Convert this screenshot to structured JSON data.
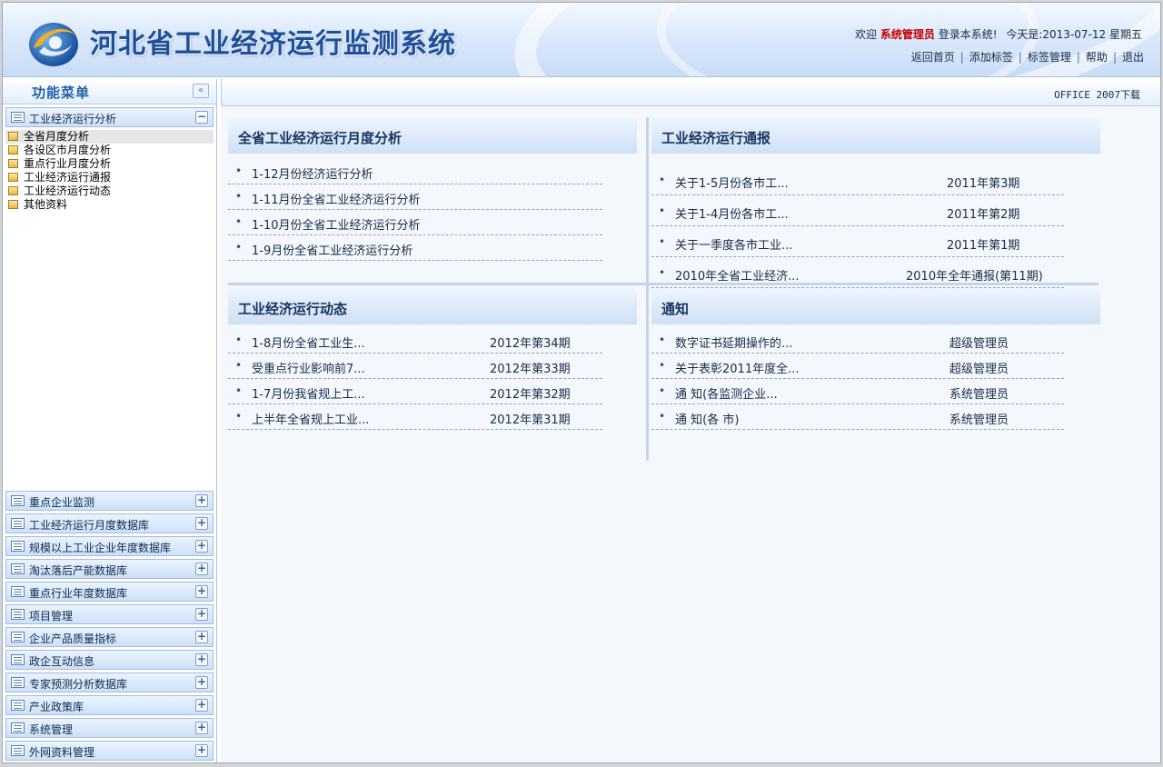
{
  "header": {
    "site_title": "河北省工业经济运行监测系统",
    "welcome_prefix": "欢迎",
    "user": "系统管理员",
    "welcome_suffix": "登录本系统!",
    "today_label": "今天是:",
    "date": "2013-07-12",
    "weekday": "星期五",
    "links": [
      "返回首页",
      "添加标签",
      "标签管理",
      "帮助",
      "退出"
    ]
  },
  "sidebar": {
    "title": "功能菜单",
    "collapse_glyph": "«",
    "active_menu": {
      "label": "工业经济运行分析",
      "toggle": "−",
      "items": [
        "全省月度分析",
        "各设区市月度分析",
        "重点行业月度分析",
        "工业经济运行通报",
        "工业经济运行动态",
        "其他资料"
      ]
    },
    "menus": [
      "重点企业监测",
      "工业经济运行月度数据库",
      "规模以上工业企业年度数据库",
      "淘汰落后产能数据库",
      "重点行业年度数据库",
      "项目管理",
      "企业产品质量指标",
      "政企互动信息",
      "专家预测分析数据库",
      "产业政策库",
      "系统管理",
      "外网资料管理"
    ],
    "expand_glyph": "+"
  },
  "main": {
    "office_link": "OFFICE 2007下载",
    "panels": {
      "monthly": {
        "title": "全省工业经济运行月度分析",
        "rows": [
          {
            "title": "1-12月份经济运行分析"
          },
          {
            "title": "1-11月份全省工业经济运行分析"
          },
          {
            "title": "1-10月份全省工业经济运行分析"
          },
          {
            "title": "1-9月份全省工业经济运行分析"
          }
        ]
      },
      "bulletin": {
        "title": "工业经济运行通报",
        "rows": [
          {
            "title": "关于1-5月份各市工...",
            "meta": "2011年第3期"
          },
          {
            "title": "关于1-4月份各市工...",
            "meta": "2011年第2期"
          },
          {
            "title": "关于一季度各市工业...",
            "meta": "2011年第1期"
          },
          {
            "title": "2010年全省工业经济...",
            "meta": "2010年全年通报(第11期)"
          }
        ]
      },
      "dynamics": {
        "title": "工业经济运行动态",
        "rows": [
          {
            "title": "1-8月份全省工业生...",
            "meta": "2012年第34期"
          },
          {
            "title": "受重点行业影响前7...",
            "meta": "2012年第33期"
          },
          {
            "title": "1-7月份我省规上工...",
            "meta": "2012年第32期"
          },
          {
            "title": "上半年全省规上工业...",
            "meta": "2012年第31期"
          }
        ]
      },
      "notice": {
        "title": "通知",
        "rows": [
          {
            "title": "数字证书延期操作的...",
            "meta": "超级管理员"
          },
          {
            "title": "关于表彰2011年度全...",
            "meta": "超级管理员"
          },
          {
            "title": "通 知(各监测企业...",
            "meta": "系统管理员"
          },
          {
            "title": "通 知(各 市)",
            "meta": "系统管理员"
          }
        ]
      }
    },
    "bullet": "•"
  }
}
